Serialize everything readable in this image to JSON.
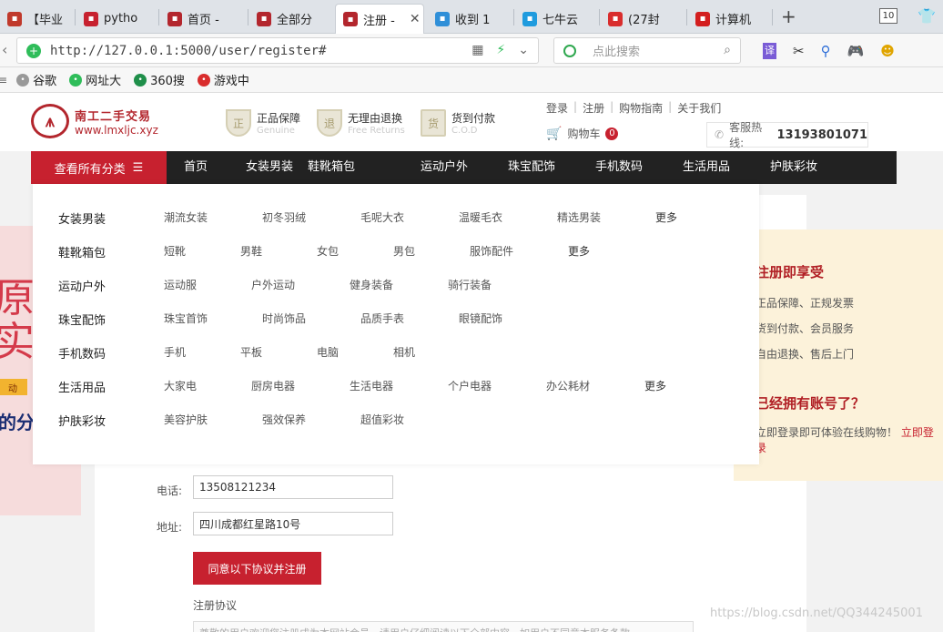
{
  "browser": {
    "tabs": [
      {
        "label": "【毕业",
        "icon": "bookmark-icon",
        "color": "#c0392b"
      },
      {
        "label": "pytho",
        "icon": "csdn-icon",
        "color": "#c7212f"
      },
      {
        "label": "首页 -",
        "icon": "site-logo-icon",
        "color": "#b3262d"
      },
      {
        "label": "全部分",
        "icon": "site-logo-icon",
        "color": "#b3262d"
      },
      {
        "label": "注册 -",
        "icon": "site-logo-icon",
        "color": "#b3262d"
      },
      {
        "label": "收到 1",
        "icon": "chrome-icon",
        "color": "#2f8fd8"
      },
      {
        "label": "七牛云",
        "icon": "qiniu-icon",
        "color": "#1f9bde"
      },
      {
        "label": "(27封",
        "icon": "mail-icon",
        "color": "#d92d2d"
      },
      {
        "label": "计算机",
        "icon": "bookmark-icon",
        "color": "#d31e1e"
      }
    ],
    "tab_count": "10",
    "url": "http://127.0.0.1:5000/user/register#",
    "search_placeholder": "点此搜索",
    "bookmarks": [
      {
        "label": "谷歌",
        "icon": "google-icon",
        "color": "#999"
      },
      {
        "label": "网址大",
        "icon": "navigation-icon",
        "color": "#2fbd5a"
      },
      {
        "label": "360搜",
        "icon": "360-search-icon",
        "color": "#1f8f4a"
      },
      {
        "label": "游戏中",
        "icon": "game-center-icon",
        "color": "#d92d2d"
      }
    ]
  },
  "site": {
    "logo_cn": "南工二手交易",
    "logo_url": "www.lmxljc.xyz",
    "features": [
      {
        "title": "正品保障",
        "sub": "Genuine",
        "icon_char": "正"
      },
      {
        "title": "无理由退换",
        "sub": "Free Returns",
        "icon_char": "退"
      },
      {
        "title": "货到付款",
        "sub": "C.O.D",
        "icon_char": "货"
      }
    ],
    "top_links": [
      "登录",
      "|",
      "注册",
      "|",
      "购物指南",
      "|",
      "关于我们"
    ],
    "cart_label": "购物车",
    "cart_count": "0",
    "hotline_label": "客服热线:",
    "hotline_number": "13193801071",
    "all_categories": "查看所有分类",
    "nav": [
      "首页",
      "女装男装",
      "鞋靴箱包",
      "运动户外",
      "珠宝配饰",
      "手机数码",
      "生活用品",
      "护肤彩妆"
    ]
  },
  "dropdown": [
    {
      "name": "女装男装",
      "subs": [
        "潮流女装",
        "初冬羽绒",
        "毛呢大衣",
        "温暖毛衣",
        "精选男装",
        "更多"
      ]
    },
    {
      "name": "鞋靴箱包",
      "subs": [
        "短靴",
        "男鞋",
        "女包",
        "男包",
        "服饰配件",
        "更多"
      ]
    },
    {
      "name": "运动户外",
      "subs": [
        "运动服",
        "户外运动",
        "健身装备",
        "骑行装备"
      ]
    },
    {
      "name": "珠宝配饰",
      "subs": [
        "珠宝首饰",
        "时尚饰品",
        "品质手表",
        "眼镜配饰"
      ]
    },
    {
      "name": "手机数码",
      "subs": [
        "手机",
        "平板",
        "电脑",
        "相机"
      ]
    },
    {
      "name": "生活用品",
      "subs": [
        "大家电",
        "厨房电器",
        "生活电器",
        "个户电器",
        "办公耗材",
        "更多"
      ]
    },
    {
      "name": "护肤彩妆",
      "subs": [
        "美容护肤",
        "强效保养",
        "超值彩妆"
      ]
    }
  ],
  "banner": {
    "big": "原\n实",
    "tag": "动",
    "foot": "的分"
  },
  "benefits": {
    "title1": "注册即享受",
    "items": [
      "正品保障、正规发票",
      "货到付款、会员服务",
      "自由退换、售后上门"
    ],
    "title2": "已经拥有账号了？",
    "login_text": "立即登录即可体验在线购物！",
    "login_link": "立即登录"
  },
  "form": {
    "phone_label": "电话:",
    "phone_value": "13508121234",
    "address_label": "地址:",
    "address_value": "四川成都红星路10号",
    "submit_label": "同意以下协议并注册",
    "agreement_title": "注册协议",
    "agreement_text": "尊敬的用户欢迎您注册成为本网站会员。请用户仔细阅读以下全部内容。如用户不同意本服务条款"
  },
  "watermark": "https://blog.csdn.net/QQ344245001"
}
